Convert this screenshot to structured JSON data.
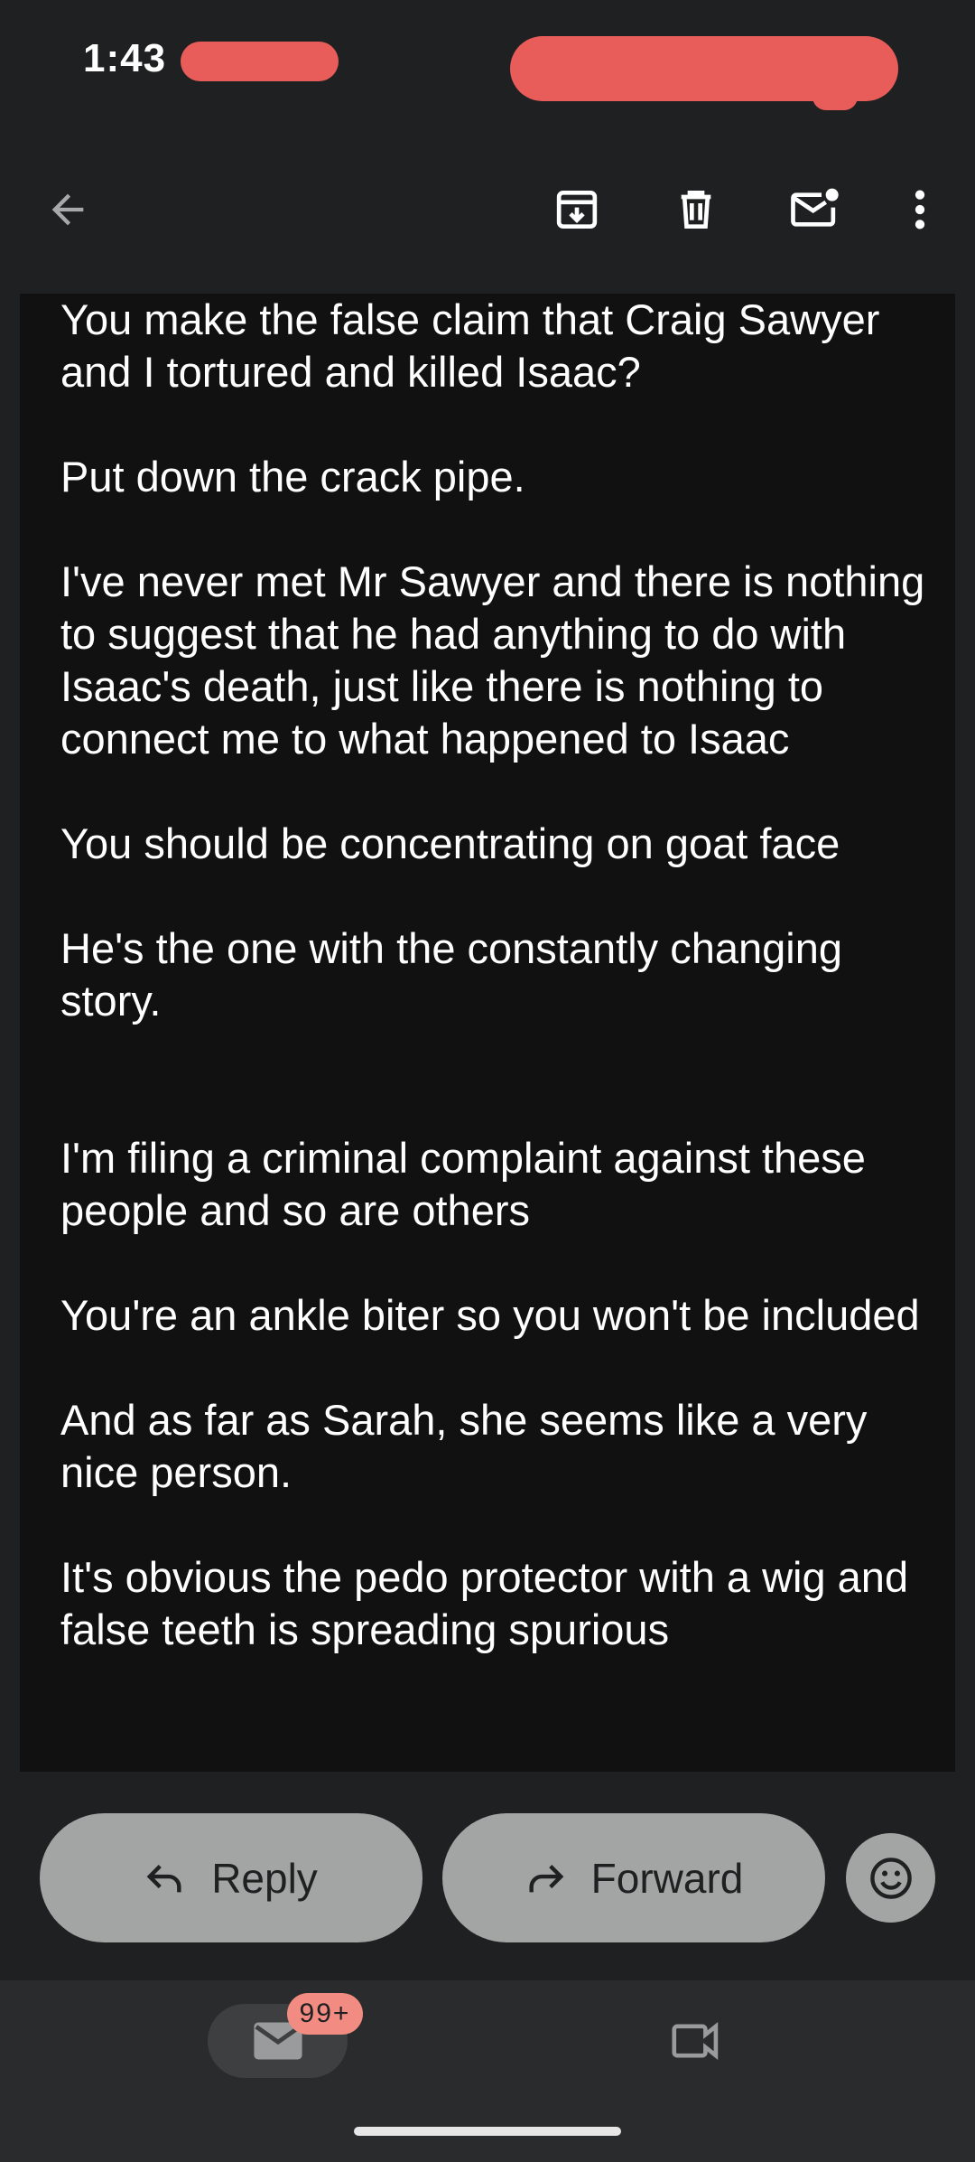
{
  "status_bar": {
    "time": "1:43"
  },
  "toolbar": {
    "icons": [
      "back-arrow-icon",
      "archive-icon",
      "delete-icon",
      "mark-unread-icon",
      "more-vert-icon"
    ]
  },
  "email": {
    "body_text": "You make the false claim that Craig Sawyer and I tortured and killed Isaac?\n\nPut down the crack pipe.\n\nI've never met Mr Sawyer and there is nothing to suggest that he had anything to do with Isaac's death, just like there is nothing to connect me to what happened to Isaac\n\nYou should be concentrating on goat face\n\nHe's the one with the constantly changing story.\n\n\nI'm filing a criminal complaint against these people and so are others\n\nYou're an ankle biter so you won't be included\n\nAnd as far as Sarah, she seems like a very nice person.\n\nIt's obvious the pedo protector with a wig and false teeth is spreading spurious"
  },
  "actions": {
    "reply_label": "Reply",
    "forward_label": "Forward"
  },
  "bottom_nav": {
    "mail_badge": "99+"
  },
  "colors": {
    "background": "#1f2021",
    "email_background": "#111111",
    "button_background": "#a3a5a4",
    "badge_background": "#f28b82",
    "redaction": "#e85c59"
  }
}
